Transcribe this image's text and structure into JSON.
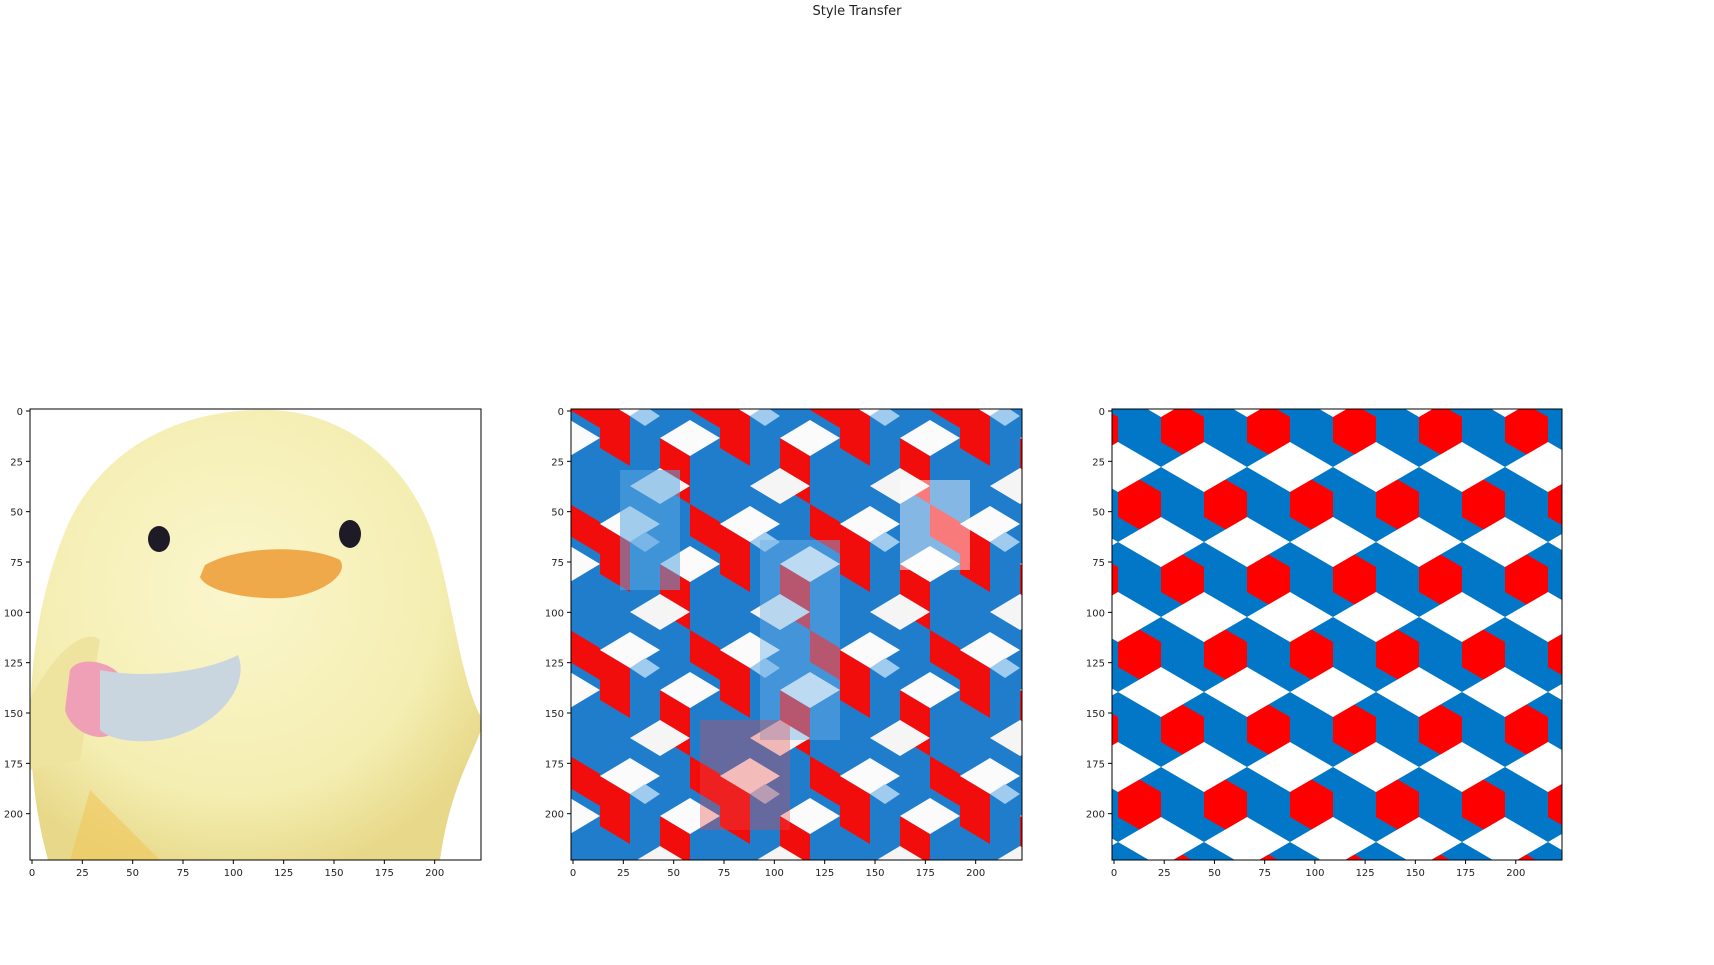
{
  "figure": {
    "suptitle": "Style Transfer"
  },
  "chart_data": [
    {
      "type": "image",
      "panel": "left",
      "content": "yellow plush chick holding a pink-handled knife",
      "xlim": [
        0,
        224
      ],
      "ylim": [
        224,
        0
      ],
      "xticks": [
        0,
        25,
        50,
        75,
        100,
        125,
        150,
        175,
        200
      ],
      "yticks": [
        0,
        25,
        50,
        75,
        100,
        125,
        150,
        175,
        200
      ],
      "colors": {
        "body": "#f6efb4",
        "beak": "#f0a94a",
        "eye": "#1e1b26",
        "knife_blade": "#c9d6e0",
        "knife_handle": "#ef9fb6"
      }
    },
    {
      "type": "image",
      "panel": "middle",
      "content": "stylized result: chick rendered with red, blue and white isometric cube texture",
      "xlim": [
        0,
        224
      ],
      "ylim": [
        224,
        0
      ],
      "xticks": [
        0,
        25,
        50,
        75,
        100,
        125,
        150,
        175,
        200
      ],
      "yticks": [
        0,
        25,
        50,
        75,
        100,
        125,
        150,
        175,
        200
      ],
      "colors": {
        "red": "#f20d0d",
        "blue": "#1f7dcc",
        "white": "#fbfbfb"
      }
    },
    {
      "type": "image",
      "panel": "right",
      "content": "style image: red, blue and white isometric cube pattern",
      "xlim": [
        0,
        224
      ],
      "ylim": [
        224,
        0
      ],
      "xticks": [
        0,
        25,
        50,
        75,
        100,
        125,
        150,
        175,
        200
      ],
      "yticks": [
        0,
        25,
        50,
        75,
        100,
        125,
        150,
        175,
        200
      ],
      "colors": {
        "red": "#ff0000",
        "blue": "#0277c8",
        "white": "#ffffff"
      }
    }
  ]
}
